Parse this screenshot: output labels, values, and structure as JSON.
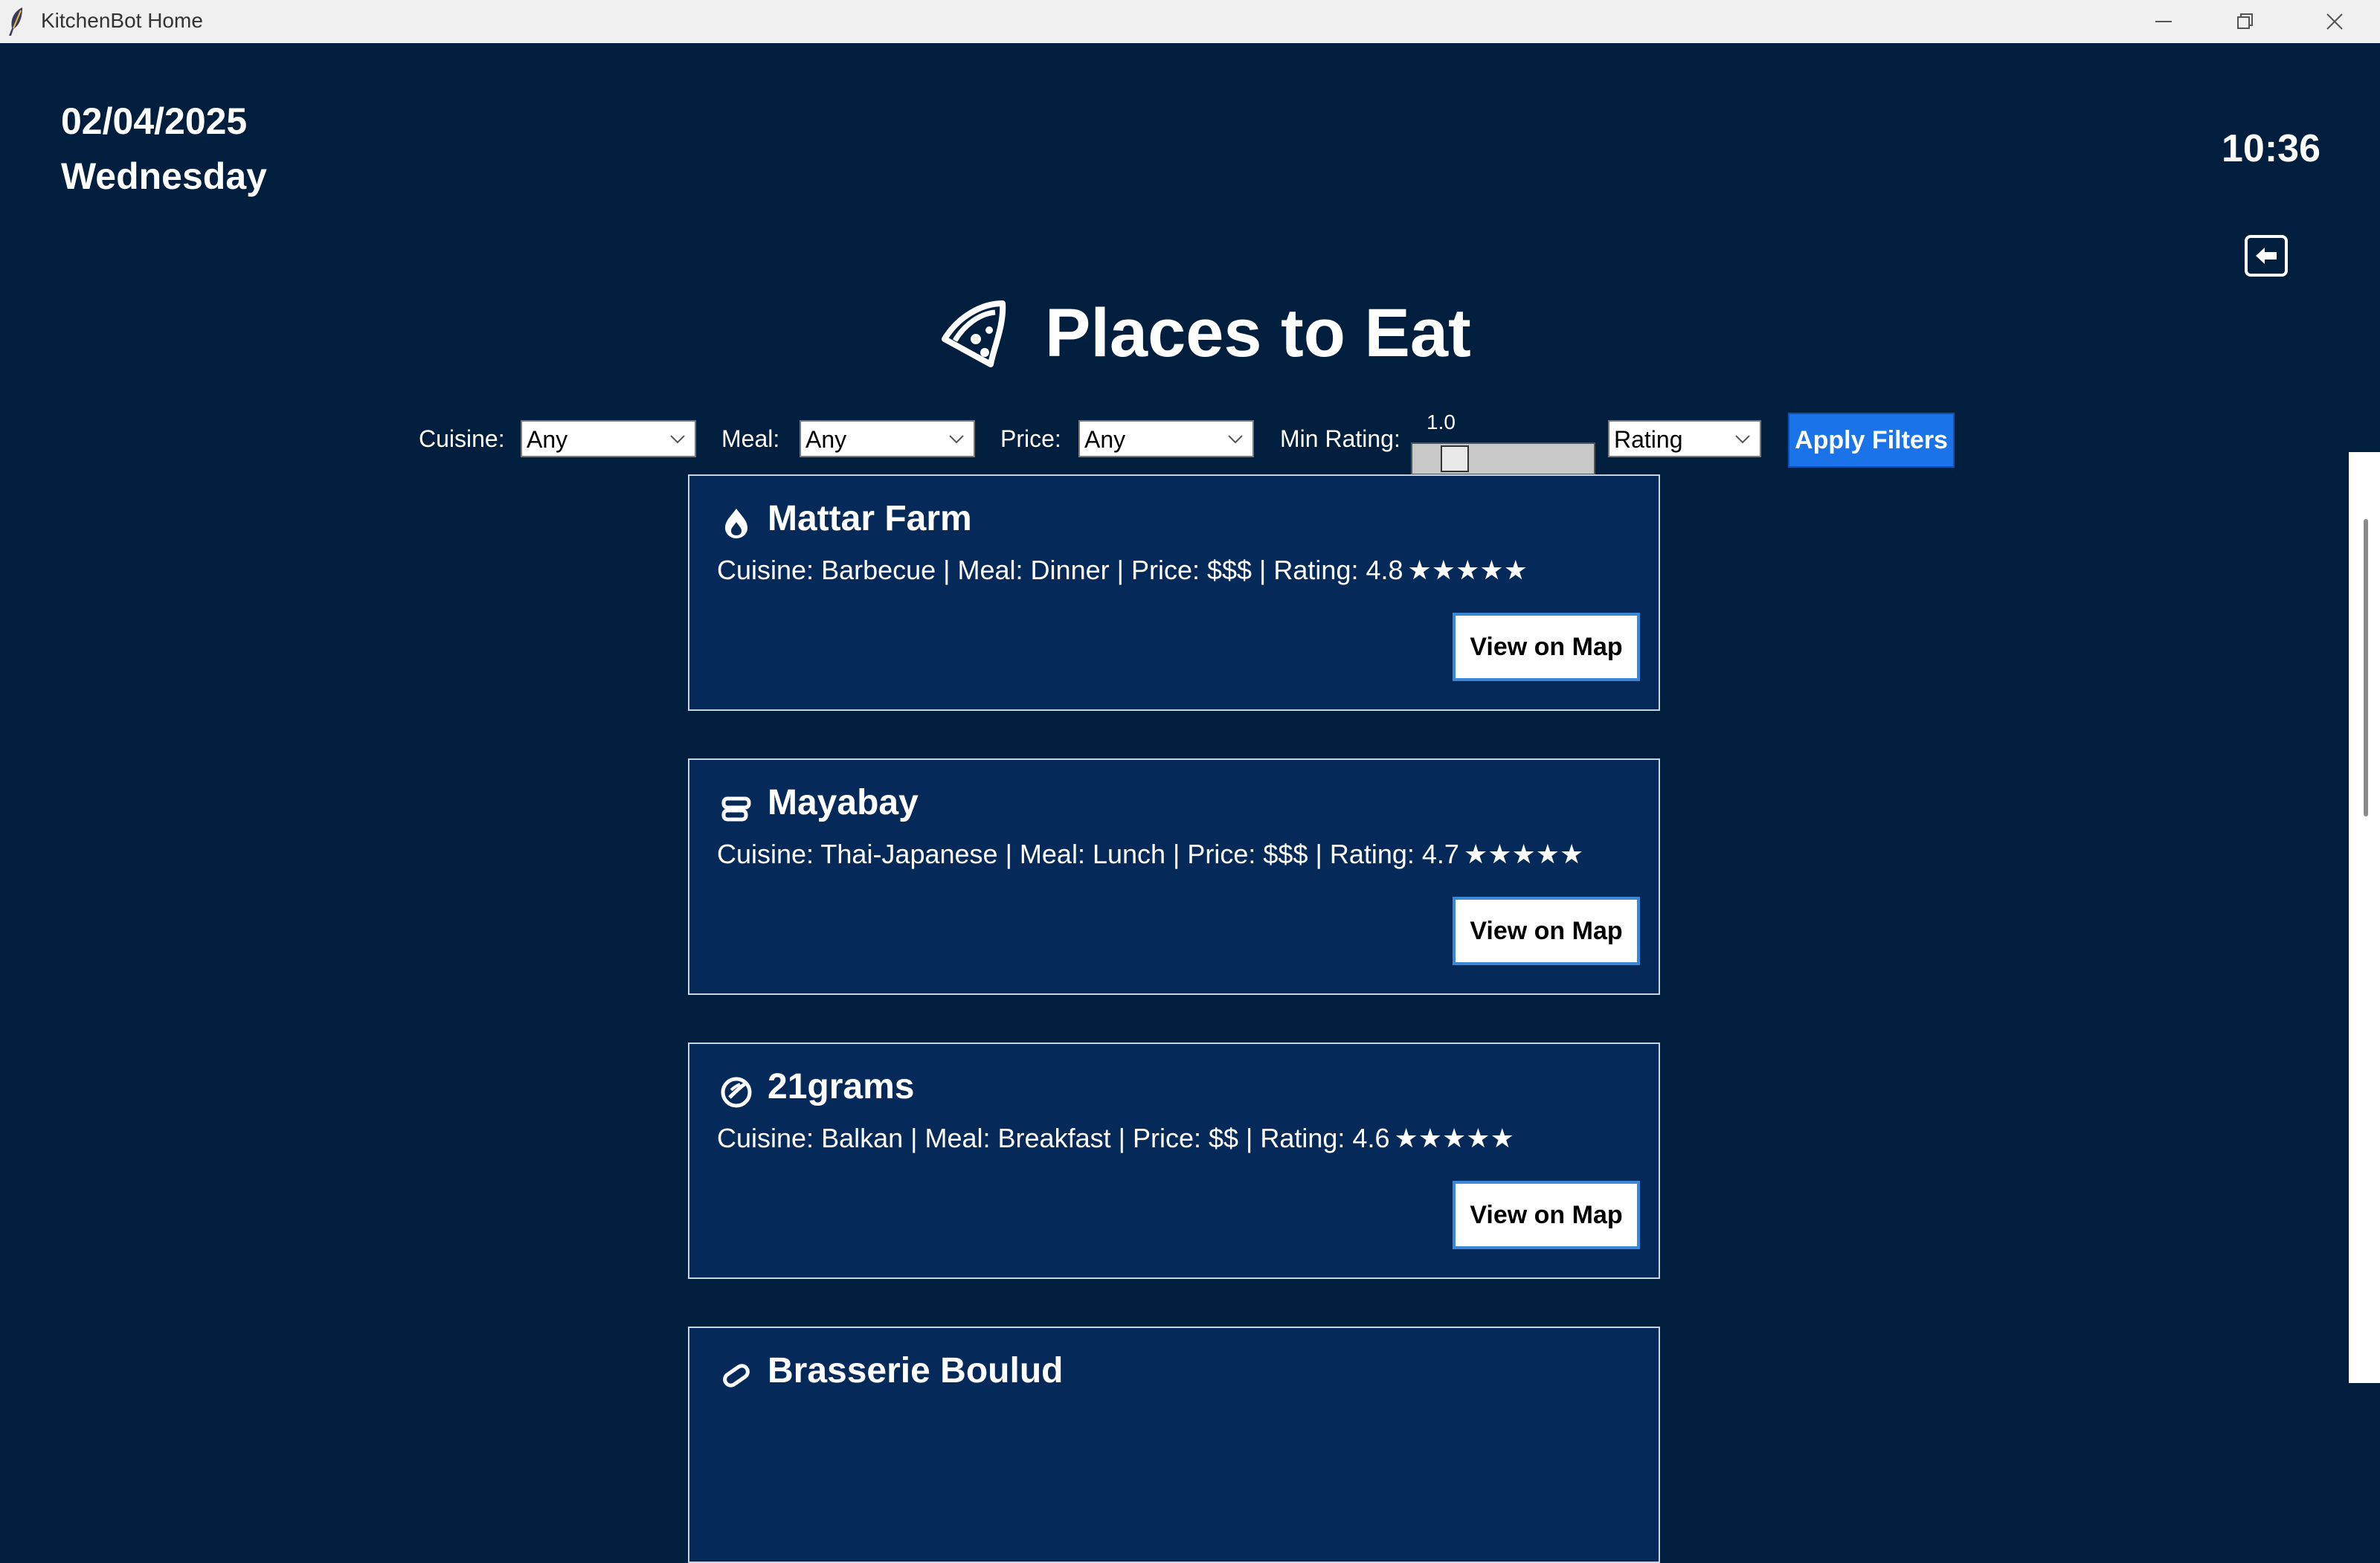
{
  "window": {
    "title": "KitchenBot Home"
  },
  "header": {
    "date": "02/04/2025",
    "day": "Wednesday",
    "time": "10:36",
    "page_title": "Places to Eat",
    "title_icon": "pizza-slice-icon",
    "back_icon": "arrow-left-icon"
  },
  "filters": {
    "cuisine_label": "Cuisine:",
    "cuisine_value": "Any",
    "meal_label": "Meal:",
    "meal_value": "Any",
    "price_label": "Price:",
    "price_value": "Any",
    "rating_label": "Min Rating:",
    "rating_value": "1.0",
    "rating_level": 0.0,
    "sort_value": "Rating",
    "apply_label": "Apply Filters"
  },
  "restaurants": [
    {
      "name": "Mattar Farm",
      "details": "Cuisine: Barbecue | Meal: Dinner | Price: $$$ | Rating: 4.8",
      "stars": "★★★★★",
      "icon": "flame-icon",
      "button": "View on Map"
    },
    {
      "name": "Mayabay",
      "details": "Cuisine: Thai-Japanese | Meal: Lunch | Price: $$$ | Rating: 4.7",
      "stars": "★★★★★",
      "icon": "bowl-icon",
      "button": "View on Map"
    },
    {
      "name": "21grams",
      "details": "Cuisine: Balkan | Meal: Breakfast | Price: $$ | Rating: 4.6",
      "stars": "★★★★★",
      "icon": "cookie-icon",
      "button": "View on Map"
    },
    {
      "name": "Brasserie Boulud",
      "details": "",
      "stars": "",
      "icon": "pill-icon",
      "button": ""
    }
  ],
  "colors": {
    "background": "#001e3d",
    "card": "#052a5a",
    "accent": "#1a73e8"
  }
}
